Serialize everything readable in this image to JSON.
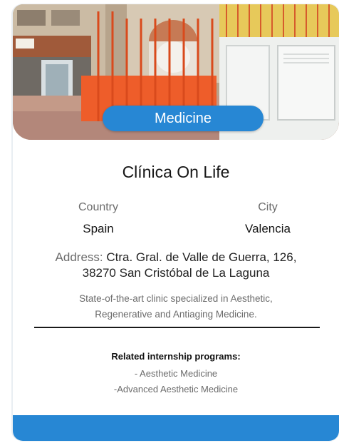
{
  "card": {
    "category": "Medicine",
    "name": "Clínica On Life",
    "country_label": "Country",
    "country": "Spain",
    "city_label": "City",
    "city": "Valencia",
    "address_label": "Address: ",
    "address_line1": "Ctra. Gral. de Valle de Guerra, 126,",
    "address_line2": "38270 San Cristóbal de La Laguna",
    "description_line1": "State-of-the-art clinic specialized in Aesthetic,",
    "description_line2": "Regenerative and Antiaging Medicine.",
    "programs_heading": "Related internship programs:",
    "programs": [
      "- Aesthetic Medicine",
      "-Advanced Aesthetic Medicine"
    ]
  },
  "colors": {
    "accent": "#2787d4",
    "text_primary": "#151515",
    "text_secondary": "#6b6b6b"
  }
}
